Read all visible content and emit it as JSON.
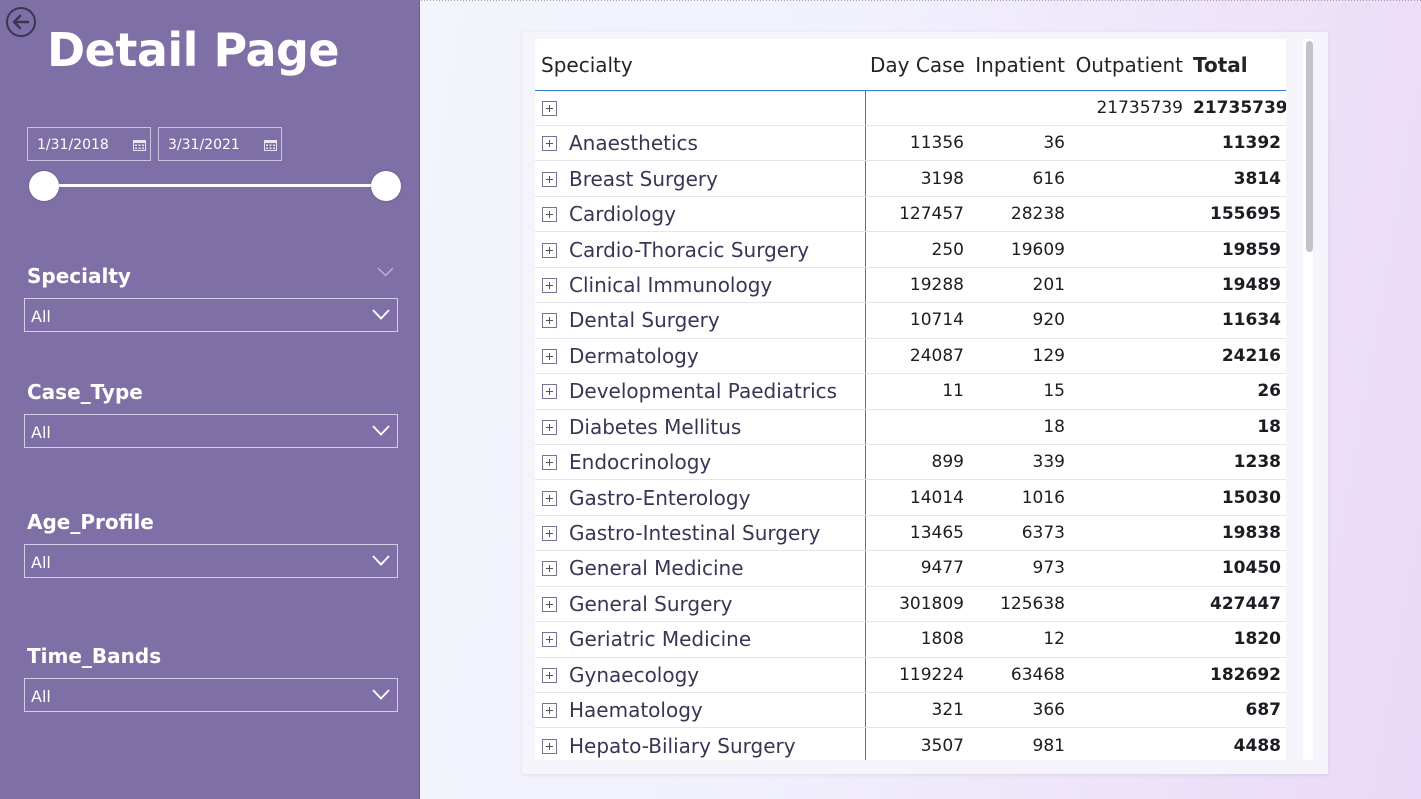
{
  "page": {
    "title": "Detail Page",
    "back_icon": "arrow-left-circle-icon"
  },
  "date_range": {
    "start": "1/31/2018",
    "end": "3/31/2021"
  },
  "filters": [
    {
      "label": "Specialty",
      "value": "All"
    },
    {
      "label": "Case_Type",
      "value": "All"
    },
    {
      "label": "Age_Profile",
      "value": "All"
    },
    {
      "label": "Time_Bands",
      "value": "All"
    }
  ],
  "table": {
    "headers": {
      "specialty": "Specialty",
      "day_case": "Day Case",
      "inpatient": "Inpatient",
      "outpatient": "Outpatient",
      "total": "Total"
    },
    "rows": [
      {
        "specialty": "",
        "day_case": "",
        "inpatient": "",
        "outpatient": "21735739",
        "total": "21735739"
      },
      {
        "specialty": "Anaesthetics",
        "day_case": "11356",
        "inpatient": "36",
        "outpatient": "",
        "total": "11392"
      },
      {
        "specialty": "Breast Surgery",
        "day_case": "3198",
        "inpatient": "616",
        "outpatient": "",
        "total": "3814"
      },
      {
        "specialty": "Cardiology",
        "day_case": "127457",
        "inpatient": "28238",
        "outpatient": "",
        "total": "155695"
      },
      {
        "specialty": "Cardio-Thoracic Surgery",
        "day_case": "250",
        "inpatient": "19609",
        "outpatient": "",
        "total": "19859"
      },
      {
        "specialty": "Clinical Immunology",
        "day_case": "19288",
        "inpatient": "201",
        "outpatient": "",
        "total": "19489"
      },
      {
        "specialty": "Dental Surgery",
        "day_case": "10714",
        "inpatient": "920",
        "outpatient": "",
        "total": "11634"
      },
      {
        "specialty": "Dermatology",
        "day_case": "24087",
        "inpatient": "129",
        "outpatient": "",
        "total": "24216"
      },
      {
        "specialty": "Developmental Paediatrics",
        "day_case": "11",
        "inpatient": "15",
        "outpatient": "",
        "total": "26"
      },
      {
        "specialty": "Diabetes Mellitus",
        "day_case": "",
        "inpatient": "18",
        "outpatient": "",
        "total": "18"
      },
      {
        "specialty": "Endocrinology",
        "day_case": "899",
        "inpatient": "339",
        "outpatient": "",
        "total": "1238"
      },
      {
        "specialty": "Gastro-Enterology",
        "day_case": "14014",
        "inpatient": "1016",
        "outpatient": "",
        "total": "15030"
      },
      {
        "specialty": "Gastro-Intestinal Surgery",
        "day_case": "13465",
        "inpatient": "6373",
        "outpatient": "",
        "total": "19838"
      },
      {
        "specialty": "General Medicine",
        "day_case": "9477",
        "inpatient": "973",
        "outpatient": "",
        "total": "10450"
      },
      {
        "specialty": "General Surgery",
        "day_case": "301809",
        "inpatient": "125638",
        "outpatient": "",
        "total": "427447"
      },
      {
        "specialty": "Geriatric Medicine",
        "day_case": "1808",
        "inpatient": "12",
        "outpatient": "",
        "total": "1820"
      },
      {
        "specialty": "Gynaecology",
        "day_case": "119224",
        "inpatient": "63468",
        "outpatient": "",
        "total": "182692"
      },
      {
        "specialty": "Haematology",
        "day_case": "321",
        "inpatient": "366",
        "outpatient": "",
        "total": "687"
      },
      {
        "specialty": "Hepato-Biliary Surgery",
        "day_case": "3507",
        "inpatient": "981",
        "outpatient": "",
        "total": "4488"
      }
    ]
  },
  "colors": {
    "sidebar": "#7e70a6",
    "accent_line": "#2f7dcc",
    "text": "#3b3555"
  }
}
